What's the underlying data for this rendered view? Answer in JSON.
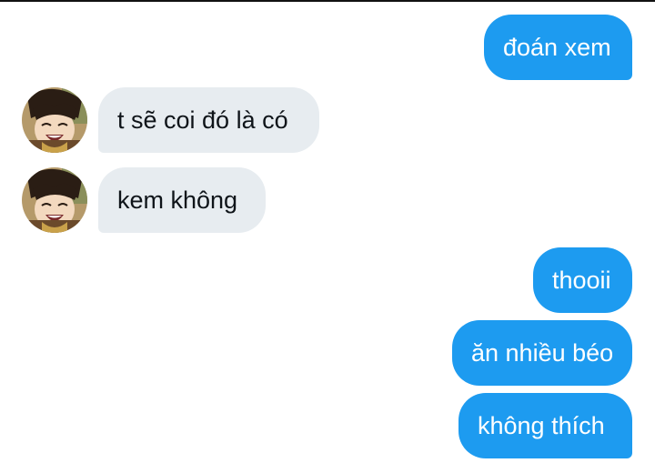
{
  "conversation": {
    "messages": [
      {
        "side": "out",
        "text": "đoán xem"
      },
      {
        "side": "in",
        "text": "t sẽ coi đó là có"
      },
      {
        "side": "in",
        "text": "kem không"
      },
      {
        "side": "out",
        "text": "thooii"
      },
      {
        "side": "out",
        "text": "ăn nhiều béo"
      },
      {
        "side": "out",
        "text": "không thích"
      }
    ]
  },
  "colors": {
    "outgoing_bubble": "#1d9bf0",
    "incoming_bubble": "#e7ecf0",
    "incoming_text": "#0f1419"
  }
}
